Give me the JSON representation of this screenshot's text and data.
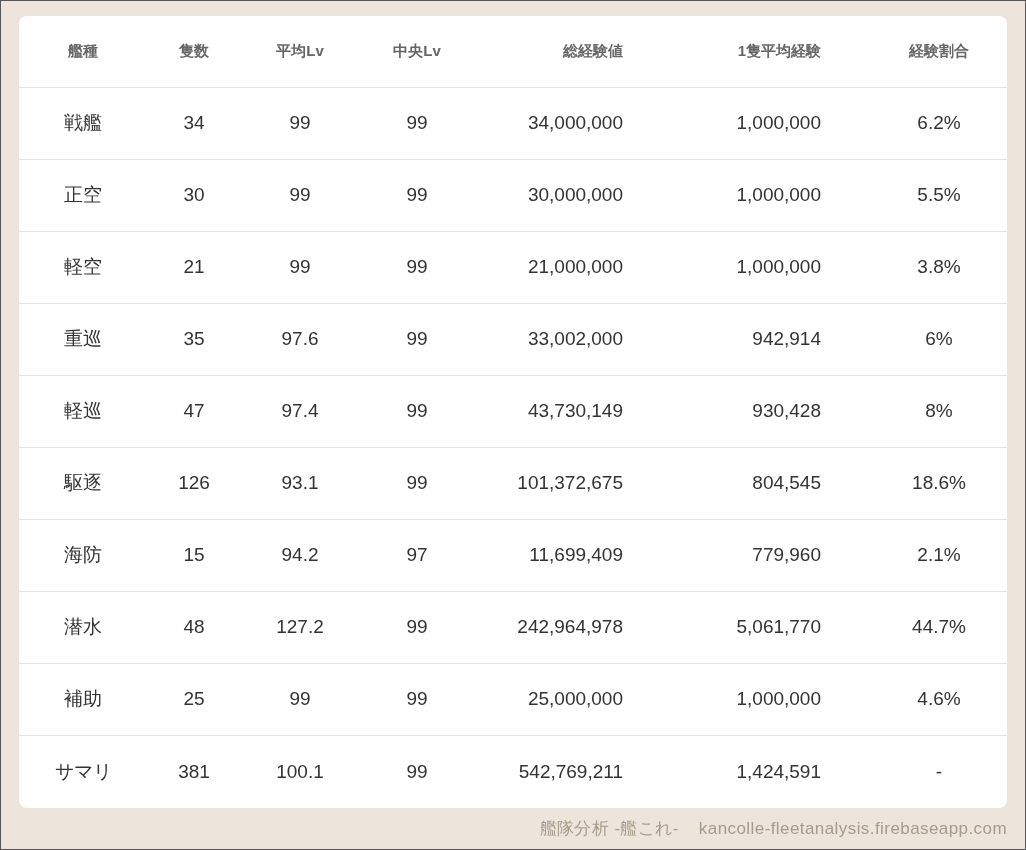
{
  "table": {
    "columns": [
      "艦種",
      "隻数",
      "平均Lv",
      "中央Lv",
      "総経験値",
      "1隻平均経験",
      "経験割合"
    ],
    "rows": [
      [
        "戦艦",
        "34",
        "99",
        "99",
        "34,000,000",
        "1,000,000",
        "6.2%"
      ],
      [
        "正空",
        "30",
        "99",
        "99",
        "30,000,000",
        "1,000,000",
        "5.5%"
      ],
      [
        "軽空",
        "21",
        "99",
        "99",
        "21,000,000",
        "1,000,000",
        "3.8%"
      ],
      [
        "重巡",
        "35",
        "97.6",
        "99",
        "33,002,000",
        "942,914",
        "6%"
      ],
      [
        "軽巡",
        "47",
        "97.4",
        "99",
        "43,730,149",
        "930,428",
        "8%"
      ],
      [
        "駆逐",
        "126",
        "93.1",
        "99",
        "101,372,675",
        "804,545",
        "18.6%"
      ],
      [
        "海防",
        "15",
        "94.2",
        "97",
        "11,699,409",
        "779,960",
        "2.1%"
      ],
      [
        "潜水",
        "48",
        "127.2",
        "99",
        "242,964,978",
        "5,061,770",
        "44.7%"
      ],
      [
        "補助",
        "25",
        "99",
        "99",
        "25,000,000",
        "1,000,000",
        "4.6%"
      ],
      [
        "サマリ",
        "381",
        "100.1",
        "99",
        "542,769,211",
        "1,424,591",
        "-"
      ]
    ]
  },
  "footer": {
    "app_name": "艦隊分析 -艦これ-",
    "url": "kancolle-fleetanalysis.firebaseapp.com"
  }
}
